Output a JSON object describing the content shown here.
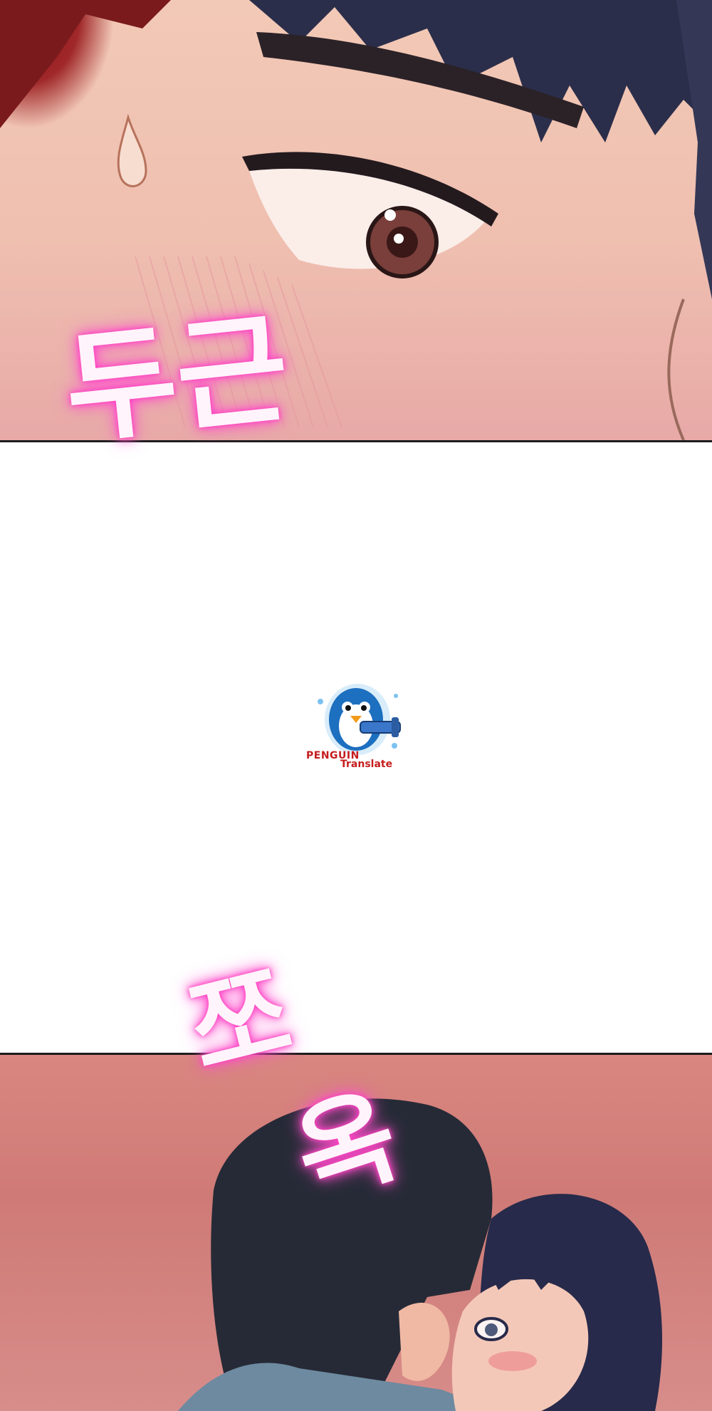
{
  "panels": {
    "top": {
      "sound_effect": "두근"
    },
    "bottom": {
      "sound_effect_1": "쪼",
      "sound_effect_2": "옥"
    }
  },
  "watermark": {
    "line1": "PENGUIN",
    "line2": "Translate"
  },
  "colors": {
    "sfx_glow": "#ff49c8",
    "panel_border": "#1d1d1d",
    "gutter": "#ffffff",
    "watermark_text": "#c51d1d"
  }
}
